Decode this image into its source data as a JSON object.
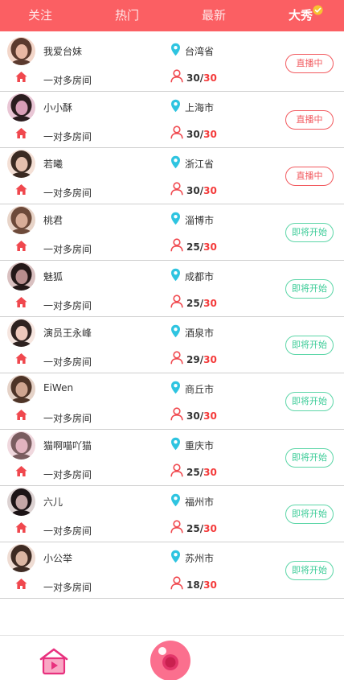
{
  "tabs": [
    {
      "label": "关注",
      "active": false
    },
    {
      "label": "热门",
      "active": false
    },
    {
      "label": "最新",
      "active": false
    },
    {
      "label": "大秀",
      "active": true
    }
  ],
  "colors": {
    "brand": "#fb5f63",
    "live": "#f25a5f",
    "upcoming": "#3dcc98",
    "pin": "#2ec4e0"
  },
  "rooms": [
    {
      "name": "我爱台妹",
      "city": "台湾省",
      "room_type": "一对多房间",
      "current": "30",
      "capacity": "30",
      "status": "直播中",
      "live": true
    },
    {
      "name": "小小酥",
      "city": "上海市",
      "room_type": "一对多房间",
      "current": "30",
      "capacity": "30",
      "status": "直播中",
      "live": true
    },
    {
      "name": "若曦",
      "city": "浙江省",
      "room_type": "一对多房间",
      "current": "30",
      "capacity": "30",
      "status": "直播中",
      "live": true
    },
    {
      "name": "桃君",
      "city": "淄博市",
      "room_type": "一对多房间",
      "current": "25",
      "capacity": "30",
      "status": "即将开始",
      "live": false
    },
    {
      "name": "魅狐",
      "city": "成都市",
      "room_type": "一对多房间",
      "current": "25",
      "capacity": "30",
      "status": "即将开始",
      "live": false
    },
    {
      "name": "演员王永峰",
      "city": "酒泉市",
      "room_type": "一对多房间",
      "current": "29",
      "capacity": "30",
      "status": "即将开始",
      "live": false
    },
    {
      "name": "EiWen",
      "city": "商丘市",
      "room_type": "一对多房间",
      "current": "30",
      "capacity": "30",
      "status": "即将开始",
      "live": false
    },
    {
      "name": "猫啊喵吖猫",
      "city": "重庆市",
      "room_type": "一对多房间",
      "current": "25",
      "capacity": "30",
      "status": "即将开始",
      "live": false
    },
    {
      "name": "六儿",
      "city": "福州市",
      "room_type": "一对多房间",
      "current": "25",
      "capacity": "30",
      "status": "即将开始",
      "live": false
    },
    {
      "name": "小公举",
      "city": "苏州市",
      "room_type": "一对多房间",
      "current": "18",
      "capacity": "30",
      "status": "即将开始",
      "live": false
    }
  ],
  "bottom_nav": [
    {
      "icon": "home-tv-icon"
    },
    {
      "icon": "live-camera-icon"
    }
  ]
}
